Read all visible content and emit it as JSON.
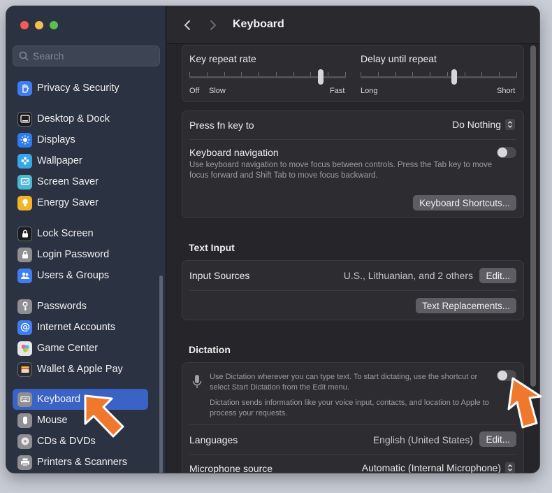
{
  "window": {
    "title": "Keyboard"
  },
  "search": {
    "placeholder": "Search"
  },
  "sidebar": {
    "items": [
      {
        "label": "Privacy & Security",
        "icon": "hand-icon",
        "color": "#3f7ef2"
      },
      {
        "label": "Desktop & Dock",
        "icon": "dock-icon",
        "color": "#1c1c1e"
      },
      {
        "label": "Displays",
        "icon": "sun-icon",
        "color": "#2c7cf0"
      },
      {
        "label": "Wallpaper",
        "icon": "flower-icon",
        "color": "#38a6e8"
      },
      {
        "label": "Screen Saver",
        "icon": "screen-saver-icon",
        "color": "#4db7d8"
      },
      {
        "label": "Energy Saver",
        "icon": "bulb-icon",
        "color": "#f0b628"
      },
      {
        "label": "Lock Screen",
        "icon": "lock-icon",
        "color": "#1c1c1e"
      },
      {
        "label": "Login Password",
        "icon": "padlock-icon",
        "color": "#8e8e93"
      },
      {
        "label": "Users & Groups",
        "icon": "users-icon",
        "color": "#3f7ef2"
      },
      {
        "label": "Passwords",
        "icon": "key-icon",
        "color": "#8e8e93"
      },
      {
        "label": "Internet Accounts",
        "icon": "at-icon",
        "color": "#3f7ef2"
      },
      {
        "label": "Game Center",
        "icon": "game-center-icon",
        "color": "#e5e5ea"
      },
      {
        "label": "Wallet & Apple Pay",
        "icon": "wallet-icon",
        "color": "#2c2c2e"
      },
      {
        "label": "Keyboard",
        "icon": "keyboard-icon",
        "color": "#8e8e93"
      },
      {
        "label": "Mouse",
        "icon": "mouse-icon",
        "color": "#8e8e93"
      },
      {
        "label": "CDs & DVDs",
        "icon": "disc-icon",
        "color": "#8e8e93"
      },
      {
        "label": "Printers & Scanners",
        "icon": "printer-icon",
        "color": "#8e8e93"
      }
    ],
    "selected": "Keyboard"
  },
  "keyboard": {
    "key_repeat": {
      "label": "Key repeat rate",
      "left": "Off",
      "left2": "Slow",
      "right": "Fast",
      "value_fraction": 0.85
    },
    "delay_repeat": {
      "label": "Delay until repeat",
      "left": "Long",
      "right": "Short",
      "value_fraction": 0.6
    },
    "fn_key": {
      "label": "Press fn key to",
      "value": "Do Nothing"
    },
    "kb_nav": {
      "label": "Keyboard navigation",
      "description": "Use keyboard navigation to move focus between controls. Press the Tab key to move focus forward and Shift Tab to move focus backward.",
      "enabled": false
    },
    "shortcuts_button": "Keyboard Shortcuts...",
    "text_input": {
      "heading": "Text Input",
      "input_sources_label": "Input Sources",
      "input_sources_value": "U.S., Lithuanian, and 2 others",
      "edit_button": "Edit...",
      "text_replacements_button": "Text Replacements..."
    },
    "dictation": {
      "heading": "Dictation",
      "description": "Use Dictation wherever you can type text. To start dictating, use the shortcut or select Start Dictation from the Edit menu.",
      "privacy_note": "Dictation sends information like your voice input, contacts, and location to Apple to process your requests.",
      "enabled": false,
      "languages_label": "Languages",
      "languages_value": "English (United States)",
      "languages_edit": "Edit...",
      "mic_label": "Microphone source",
      "mic_value": "Automatic (Internal Microphone)"
    }
  },
  "colors": {
    "accent": "#3b63c6",
    "arrow": "#f0782c"
  }
}
